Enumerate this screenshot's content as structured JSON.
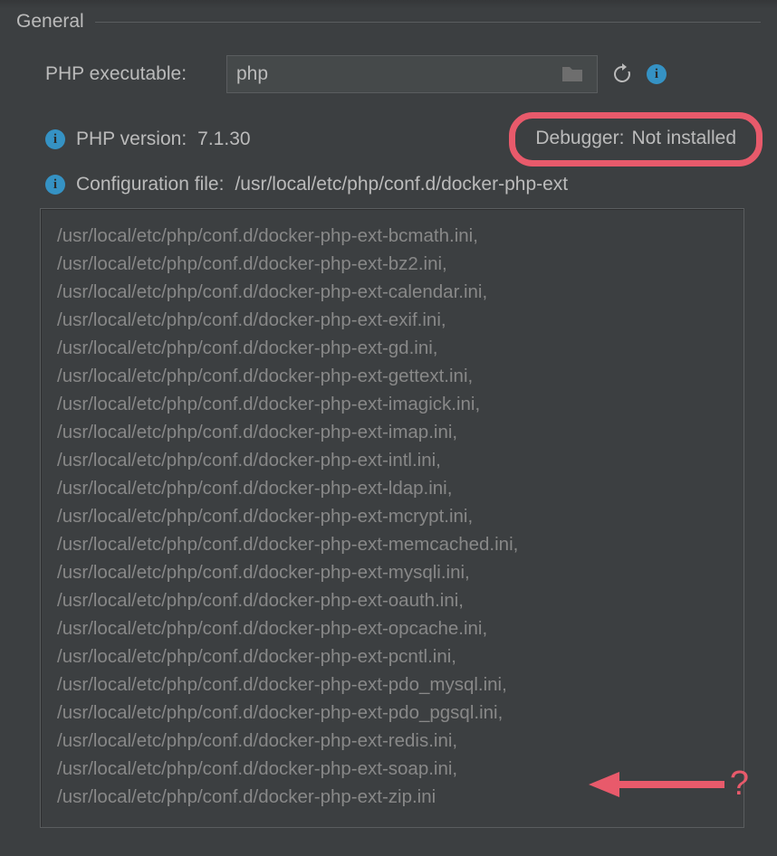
{
  "section_title": "General",
  "executable": {
    "label": "PHP executable:",
    "value": "php"
  },
  "version": {
    "label": "PHP version:",
    "value": "7.1.30"
  },
  "debugger": {
    "label": "Debugger:",
    "value": "Not installed"
  },
  "configuration": {
    "label": "Configuration file:",
    "path": "/usr/local/etc/php/conf.d/docker-php-ext"
  },
  "annotation_mark": "?",
  "conf_lines": [
    "/usr/local/etc/php/conf.d/docker-php-ext-bcmath.ini,",
    "/usr/local/etc/php/conf.d/docker-php-ext-bz2.ini,",
    "/usr/local/etc/php/conf.d/docker-php-ext-calendar.ini,",
    "/usr/local/etc/php/conf.d/docker-php-ext-exif.ini,",
    "/usr/local/etc/php/conf.d/docker-php-ext-gd.ini,",
    "/usr/local/etc/php/conf.d/docker-php-ext-gettext.ini,",
    "/usr/local/etc/php/conf.d/docker-php-ext-imagick.ini,",
    "/usr/local/etc/php/conf.d/docker-php-ext-imap.ini,",
    "/usr/local/etc/php/conf.d/docker-php-ext-intl.ini,",
    "/usr/local/etc/php/conf.d/docker-php-ext-ldap.ini,",
    "/usr/local/etc/php/conf.d/docker-php-ext-mcrypt.ini,",
    "/usr/local/etc/php/conf.d/docker-php-ext-memcached.ini,",
    "/usr/local/etc/php/conf.d/docker-php-ext-mysqli.ini,",
    "/usr/local/etc/php/conf.d/docker-php-ext-oauth.ini,",
    "/usr/local/etc/php/conf.d/docker-php-ext-opcache.ini,",
    "/usr/local/etc/php/conf.d/docker-php-ext-pcntl.ini,",
    "/usr/local/etc/php/conf.d/docker-php-ext-pdo_mysql.ini,",
    "/usr/local/etc/php/conf.d/docker-php-ext-pdo_pgsql.ini,",
    "/usr/local/etc/php/conf.d/docker-php-ext-redis.ini,",
    "/usr/local/etc/php/conf.d/docker-php-ext-soap.ini,",
    "/usr/local/etc/php/conf.d/docker-php-ext-zip.ini"
  ]
}
